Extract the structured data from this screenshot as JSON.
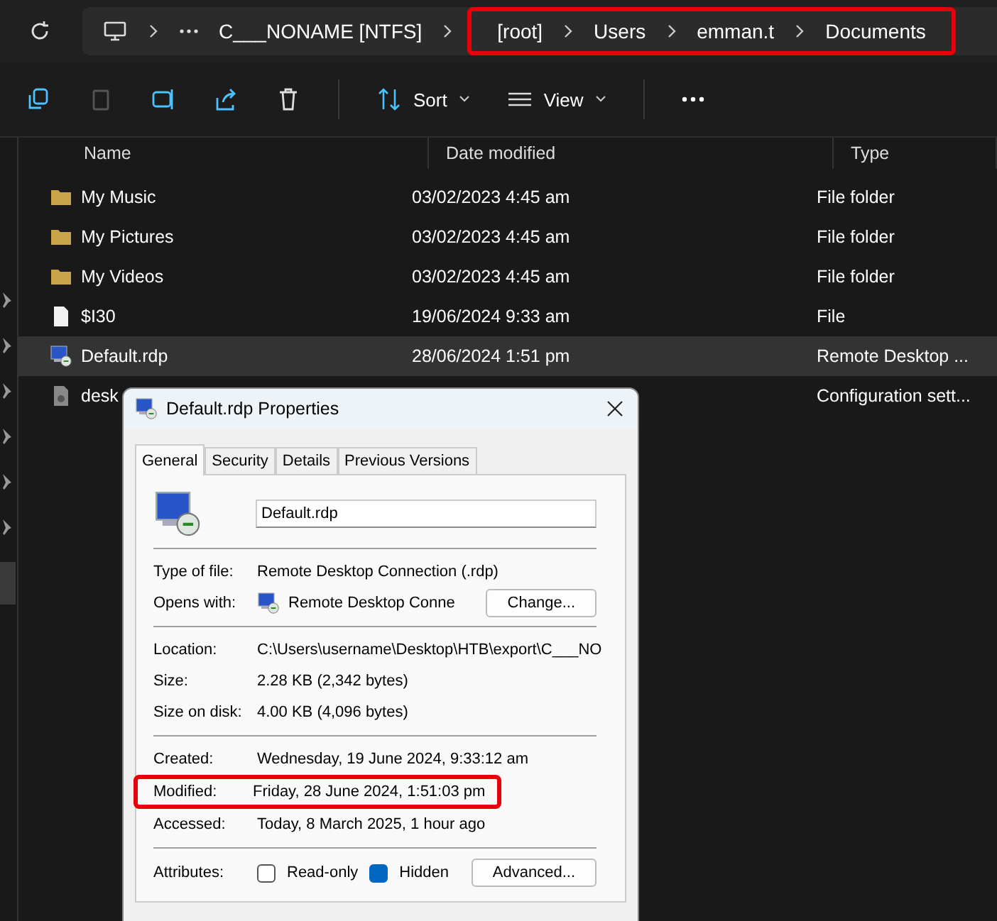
{
  "address_bar": {
    "leading": "C___NONAME [NTFS]",
    "highlighted_path": [
      "[root]",
      "Users",
      "emman.t",
      "Documents"
    ]
  },
  "toolbar": {
    "sort": "Sort",
    "view": "View"
  },
  "columns": [
    "Name",
    "Date modified",
    "Type"
  ],
  "rows": [
    {
      "name": "My Music",
      "date": "03/02/2023 4:45 am",
      "type": "File folder",
      "kind": "folder",
      "selected": false
    },
    {
      "name": "My Pictures",
      "date": "03/02/2023 4:45 am",
      "type": "File folder",
      "kind": "folder",
      "selected": false
    },
    {
      "name": "My Videos",
      "date": "03/02/2023 4:45 am",
      "type": "File folder",
      "kind": "folder",
      "selected": false
    },
    {
      "name": "$I30",
      "date": "19/06/2024 9:33 am",
      "type": "File",
      "kind": "file",
      "selected": false
    },
    {
      "name": "Default.rdp",
      "date": "28/06/2024 1:51 pm",
      "type": "Remote Desktop ...",
      "kind": "rdp",
      "selected": true
    },
    {
      "name": "desk",
      "date": "",
      "type": "Configuration sett...",
      "kind": "config",
      "selected": false
    }
  ],
  "dialog": {
    "title": "Default.rdp Properties",
    "tabs": [
      {
        "label": "General",
        "selected": true
      },
      {
        "label": "Security",
        "selected": false
      },
      {
        "label": "Details",
        "selected": false
      },
      {
        "label": "Previous Versions",
        "selected": false
      }
    ],
    "file_name": "Default.rdp",
    "groups": [
      [
        {
          "label": "Type of file:",
          "value": "Remote Desktop Connection (.rdp)",
          "kind": "text",
          "highlighted": false
        },
        {
          "label": "Opens with:",
          "value": "Remote Desktop Conne",
          "kind": "opens",
          "button": "Change...",
          "highlighted": false
        }
      ],
      [
        {
          "label": "Location:",
          "value": "C:\\Users\\username\\Desktop\\HTB\\export\\C___NO",
          "kind": "text",
          "highlighted": false
        },
        {
          "label": "Size:",
          "value": "2.28 KB (2,342 bytes)",
          "kind": "text",
          "highlighted": false
        },
        {
          "label": "Size on disk:",
          "value": "4.00 KB (4,096 bytes)",
          "kind": "text",
          "highlighted": false
        }
      ],
      [
        {
          "label": "Created:",
          "value": "Wednesday, 19 June 2024, 9:33:12 am",
          "kind": "text",
          "highlighted": false
        },
        {
          "label": "Modified:",
          "value": "Friday, 28 June 2024, 1:51:03 pm",
          "kind": "text",
          "highlighted": true
        },
        {
          "label": "Accessed:",
          "value": "Today, 8 March 2025, 1 hour ago",
          "kind": "text",
          "highlighted": false
        }
      ]
    ],
    "attributes": {
      "label": "Attributes:",
      "checkboxes": [
        {
          "label": "Read-only",
          "checked": false
        },
        {
          "label": "Hidden",
          "checked": true
        }
      ],
      "button": "Advanced..."
    }
  }
}
